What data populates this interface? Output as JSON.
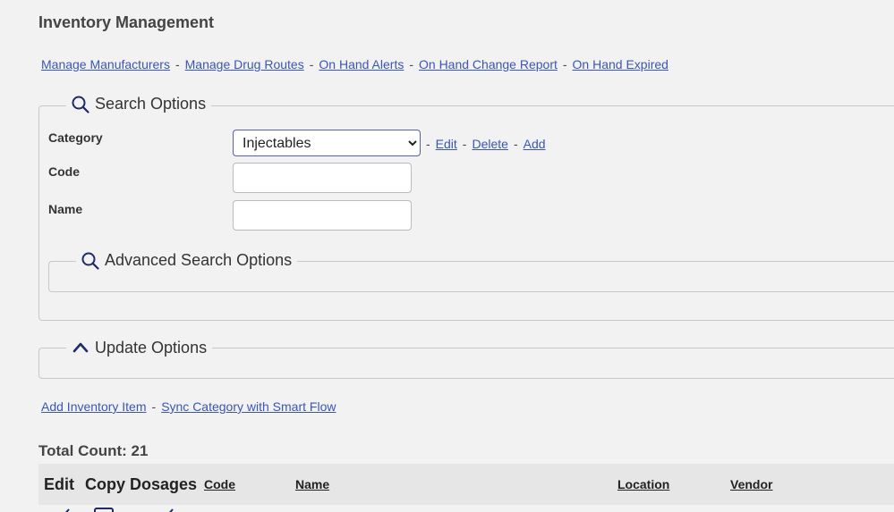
{
  "page": {
    "title": "Inventory Management"
  },
  "top_links": [
    {
      "label": "Manage Manufacturers"
    },
    {
      "label": "Manage Drug Routes"
    },
    {
      "label": "On Hand Alerts"
    },
    {
      "label": "On Hand Change Report"
    },
    {
      "label": "On Hand Expired"
    }
  ],
  "separator": "-",
  "search_options": {
    "legend": "Search Options",
    "icon": "search-icon",
    "category": {
      "label": "Category",
      "selected": "Injectables",
      "links": [
        {
          "label": "Edit"
        },
        {
          "label": "Delete"
        },
        {
          "label": "Add"
        }
      ]
    },
    "code": {
      "label": "Code",
      "value": ""
    },
    "name": {
      "label": "Name",
      "value": ""
    },
    "advanced": {
      "legend": "Advanced Search Options",
      "icon": "search-icon"
    }
  },
  "update_options": {
    "legend": "Update Options",
    "icon": "chevron-up-icon"
  },
  "action_links": [
    {
      "label": "Add Inventory Item"
    },
    {
      "label": "Sync Category with Smart Flow"
    }
  ],
  "total_count": "Total Count: 21",
  "table": {
    "columns": [
      {
        "label": "Edit",
        "sortable": false
      },
      {
        "label": "Copy",
        "sortable": false
      },
      {
        "label": "Dosages",
        "sortable": false
      },
      {
        "label": "Code",
        "sortable": true
      },
      {
        "label": "Name",
        "sortable": true
      },
      {
        "label": "Location",
        "sortable": true
      },
      {
        "label": "Vendor",
        "sortable": true
      }
    ]
  },
  "colors": {
    "background": "#f2f2f2",
    "link": "#3a56b5",
    "icon": "#1f2a6b",
    "header_row": "#e6e6e6"
  }
}
